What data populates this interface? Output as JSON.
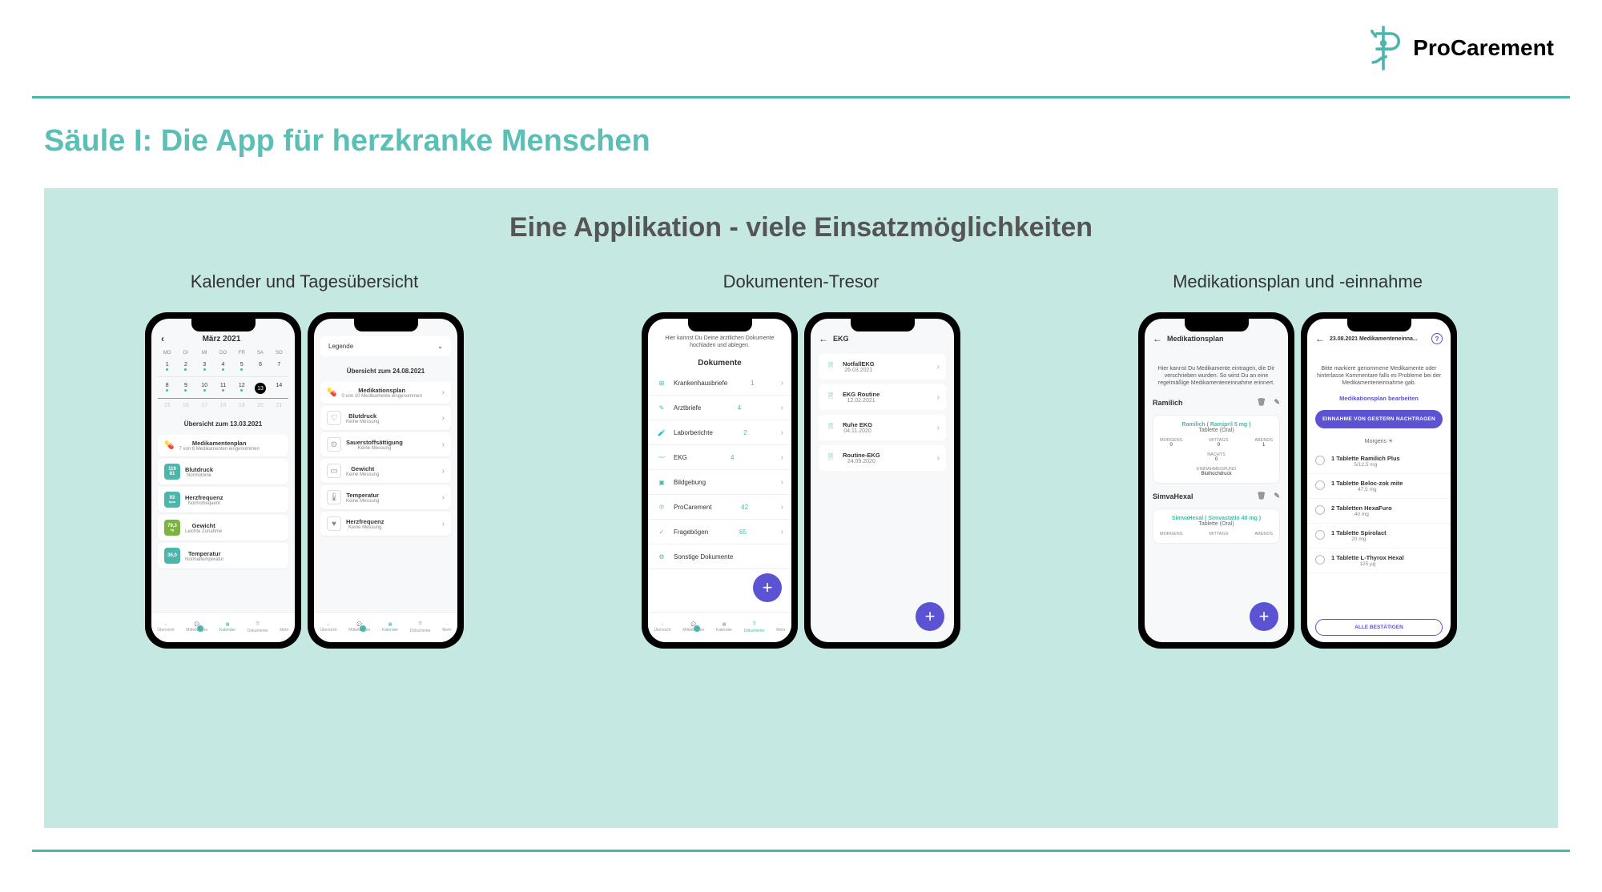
{
  "brand": "ProCarement",
  "title": "Säule I: Die App für herzkranke Menschen",
  "subtitle": "Eine Applikation - viele Einsatzmöglichkeiten",
  "col1": {
    "title": "Kalender und Tagesübersicht",
    "month": "März 2021",
    "days": [
      "MO",
      "DI",
      "MI",
      "DO",
      "FR",
      "SA",
      "SO"
    ],
    "week1": [
      "1",
      "2",
      "3",
      "4",
      "5",
      "6",
      "7"
    ],
    "week2": [
      "8",
      "9",
      "10",
      "11",
      "12",
      "13",
      "14"
    ],
    "week3": [
      "15",
      "16",
      "17",
      "18",
      "19",
      "20",
      "21"
    ],
    "overviewDate": "Übersicht zum 13.03.2021",
    "meds": {
      "title": "Medikamentenplan",
      "sub": "7 von 8 Medikamenten eingenommen"
    },
    "bp": {
      "badge1": "119",
      "badge2": "81",
      "title": "Blutdruck",
      "sub": "Normotonie"
    },
    "hr": {
      "badge": "93",
      "unit": "bpm",
      "title": "Herzfrequenz",
      "sub": "Normofrequent"
    },
    "wt": {
      "badge": "79,3",
      "unit": "kg",
      "title": "Gewicht",
      "sub": "Leichte Zunahme"
    },
    "tmp": {
      "badge": "36,0",
      "title": "Temperatur",
      "sub": "Normaltemperatur"
    }
  },
  "col1b": {
    "legend": "Legende",
    "overviewDate": "Übersicht zum 24.08.2021",
    "items": [
      {
        "title": "Medikationsplan",
        "sub": "0 von 10 Medikamente eingenommen"
      },
      {
        "title": "Blutdruck",
        "sub": "Keine Messung"
      },
      {
        "title": "Sauerstoffsättigung",
        "sub": "Keine Messung"
      },
      {
        "title": "Gewicht",
        "sub": "Keine Messung"
      },
      {
        "title": "Temperatur",
        "sub": "Keine Messung"
      },
      {
        "title": "Herzfrequenz",
        "sub": "Keine Messung"
      }
    ]
  },
  "tabs": [
    "Übersicht",
    "Mitteilungen",
    "Kalender",
    "Dokumente",
    "Mehr"
  ],
  "col2": {
    "title": "Dokumenten-Tresor",
    "intro": "Hier kannst Du Deine ärztlichen Dokumente hochladen und ablegen.",
    "heading": "Dokumente",
    "rows": [
      {
        "label": "Krankenhausbriefe",
        "count": "1"
      },
      {
        "label": "Arztbriefe",
        "count": "4"
      },
      {
        "label": "Laborberichte",
        "count": "2"
      },
      {
        "label": "EKG",
        "count": "4"
      },
      {
        "label": "Bildgebung",
        "count": ""
      },
      {
        "label": "ProCarement",
        "count": "42"
      },
      {
        "label": "Fragebögen",
        "count": "65"
      },
      {
        "label": "Sonstige Dokumente",
        "count": ""
      }
    ]
  },
  "col2b": {
    "header": "EKG",
    "items": [
      {
        "name": "NotfallEKG",
        "date": "26.03.2021"
      },
      {
        "name": "EKG Routine",
        "date": "12.02.2021"
      },
      {
        "name": "Ruhe EKG",
        "date": "04.11.2020"
      },
      {
        "name": "Routine-EKG",
        "date": "24.09.2020"
      }
    ]
  },
  "col3": {
    "title": "Medikationsplan und -einnahme",
    "header": "Medikationsplan",
    "intro": "Hier kannst Du Medikamente eintragen, die Dir verschrieben wurden. So wirst Du an eine regelmäßige Medikamenteneinnahme erinnert.",
    "drug1": {
      "name": "Ramilich",
      "line": "Ramilich ( Ramipril   5 mg )",
      "form": "Tablette (Oral)",
      "morgens": "0",
      "mittags": "0",
      "abends": "1",
      "nachts": "0",
      "reason": "Bluthochdruck"
    },
    "labels": {
      "morgens": "MORGENS",
      "mittags": "MITTAGS",
      "abends": "ABENDS",
      "nachts": "NACHTS",
      "reason": "EINNAHMEGRUND"
    },
    "drug2": {
      "name": "SimvaHexal",
      "line": "SimvaHexal ( Simvastatin   40 mg )",
      "form": "Tablette (Oral)"
    }
  },
  "col3b": {
    "header": "23.08.2021 Medikamenteneinna...",
    "intro": "Bitte markiere genommene Medikamente oder hinterlasse Kommentare falls es Probleme bei der Medikamenteneinnahme gab.",
    "edit": "Medikationsplan bearbeiten",
    "button": "EINNAHME VON GESTERN NACHTRAGEN",
    "section": "Morgens",
    "items": [
      {
        "name": "1 Tablette Ramilich Plus",
        "dose": "5/12,5 mg"
      },
      {
        "name": "1 Tablette Beloc-zok mite",
        "dose": "47,5 mg"
      },
      {
        "name": "2 Tabletten HexaFuro",
        "dose": "40 mg"
      },
      {
        "name": "1 Tablette Spirolact",
        "dose": "20 mg"
      },
      {
        "name": "1 Tablette L-Thyrox Hexal",
        "dose": "125 µg"
      }
    ],
    "confirm": "ALLE BESTÄTIGEN"
  }
}
